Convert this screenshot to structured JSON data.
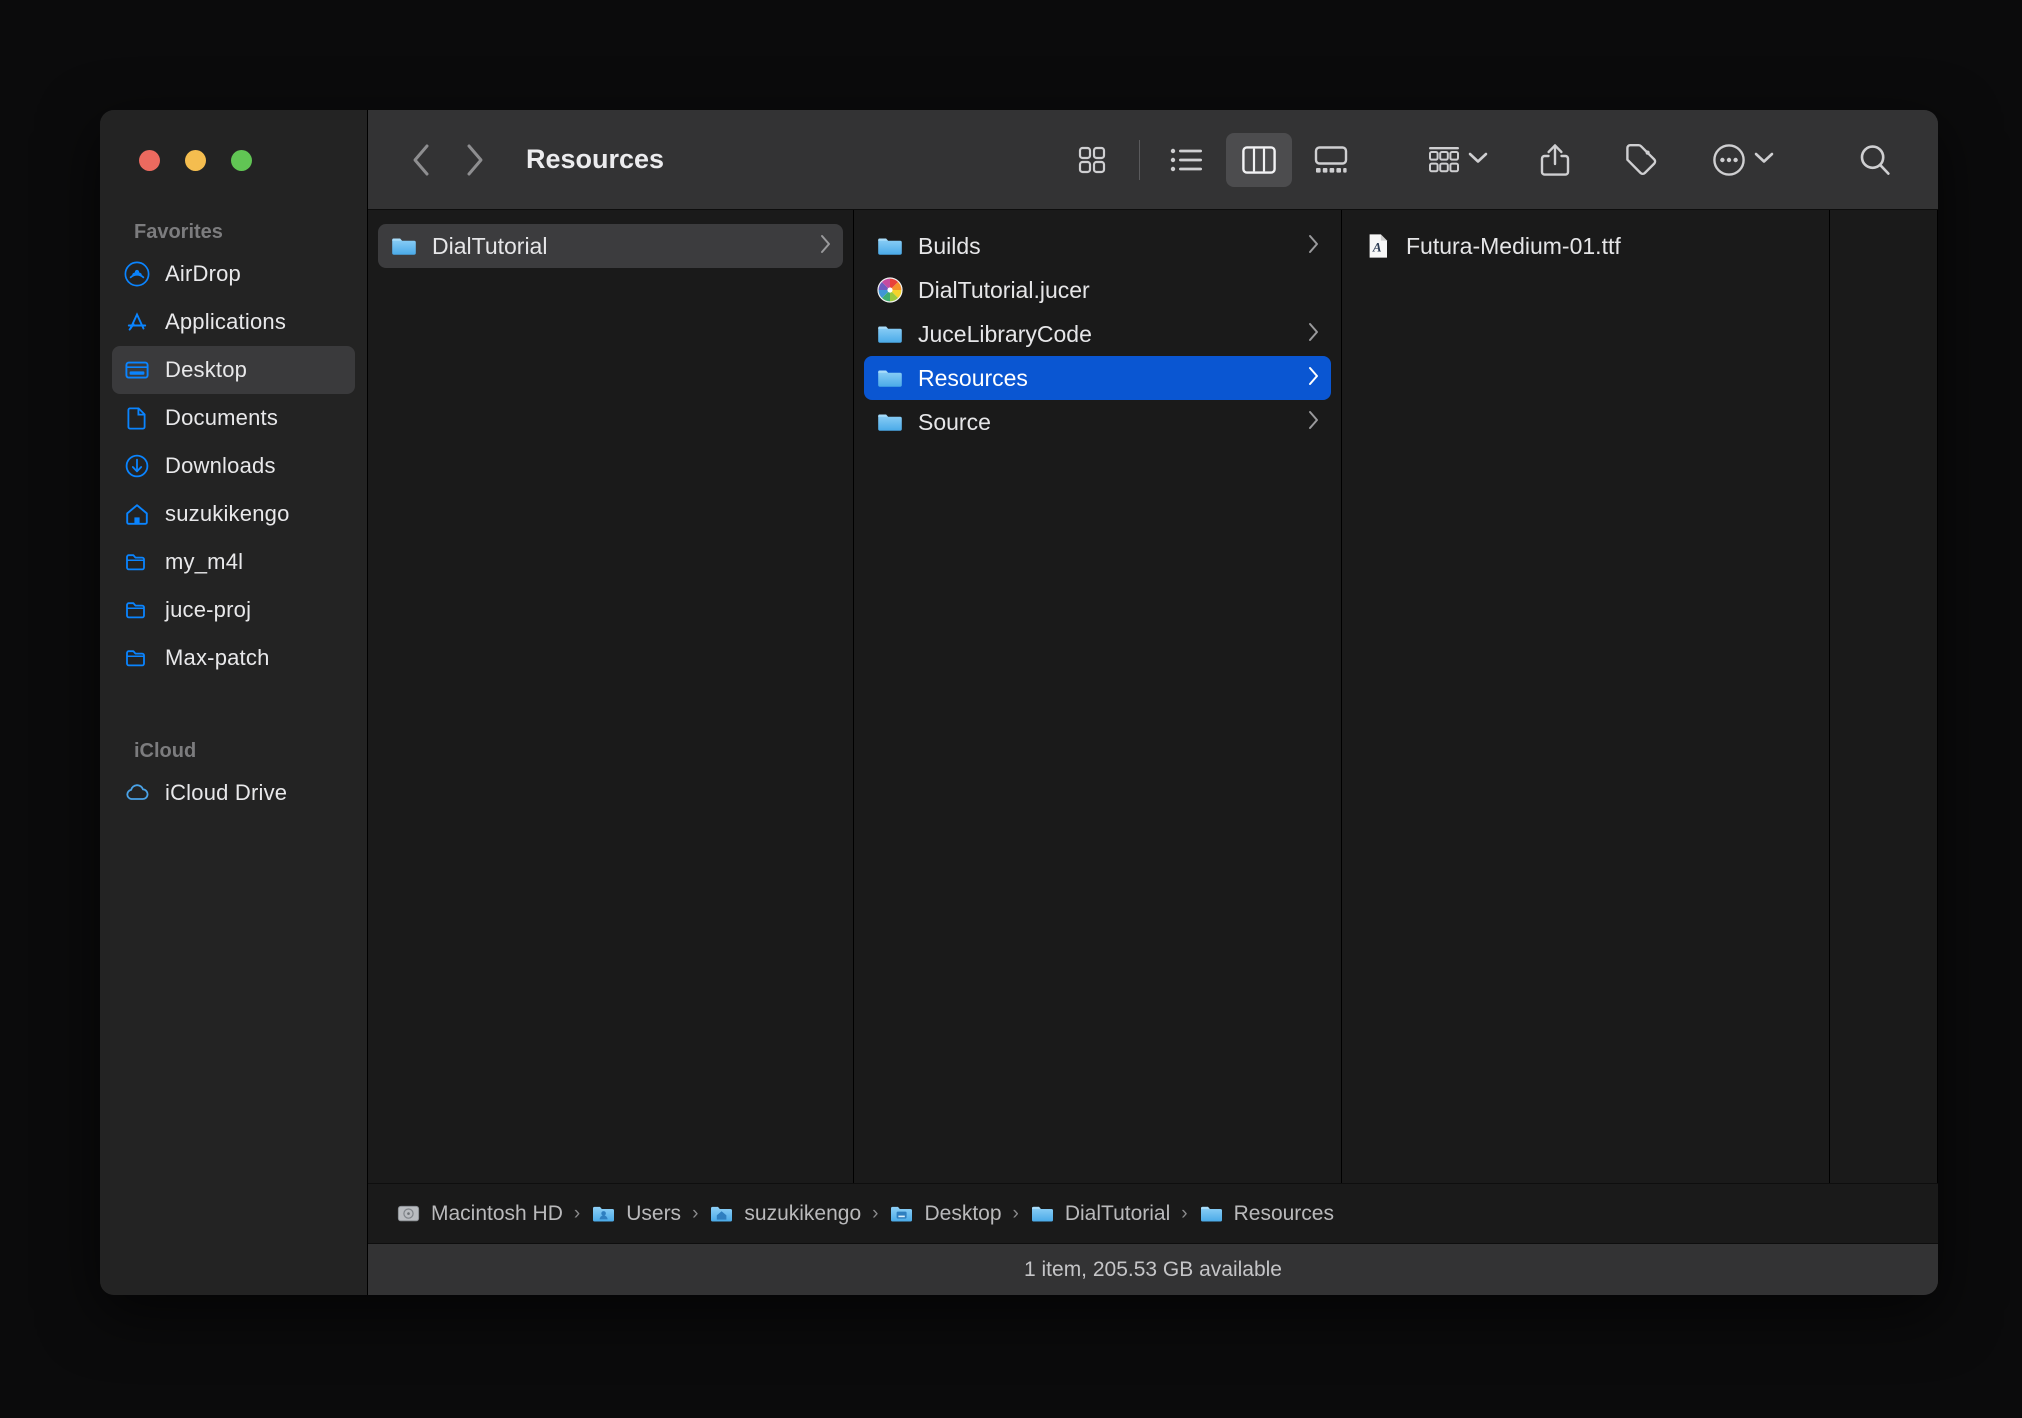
{
  "window": {
    "title": "Resources",
    "traffic_lights": [
      {
        "name": "close",
        "color": "#ec6a5f"
      },
      {
        "name": "minimize",
        "color": "#f4bd4f"
      },
      {
        "name": "maximize",
        "color": "#61c554"
      }
    ]
  },
  "colors": {
    "accent_selected": "#0a56d2",
    "selected_inactive": "#3c3c3e",
    "folder_blue": "#63b9f0",
    "sidebar_icon_blue": "#0a84ff",
    "toolbar_bg": "#333334",
    "sidebar_bg": "#232323",
    "content_bg": "#1a1a1a"
  },
  "toolbar": {
    "back_icon": "chevron-left-icon",
    "forward_icon": "chevron-right-icon",
    "view_modes": [
      {
        "name": "icon-view",
        "icon": "grid-icon",
        "active": false
      },
      {
        "name": "list-view",
        "icon": "list-icon",
        "active": false
      },
      {
        "name": "column-view",
        "icon": "columns-icon",
        "active": true
      },
      {
        "name": "gallery-view",
        "icon": "gallery-icon",
        "active": false
      }
    ],
    "actions": [
      {
        "name": "group-by",
        "icon": "group-icon",
        "has_chevron": true
      },
      {
        "name": "share",
        "icon": "share-icon",
        "has_chevron": false
      },
      {
        "name": "tags",
        "icon": "tag-icon",
        "has_chevron": false
      },
      {
        "name": "more",
        "icon": "ellipsis-circle-icon",
        "has_chevron": true
      },
      {
        "name": "search",
        "icon": "search-icon",
        "has_chevron": false
      }
    ]
  },
  "sidebar": {
    "sections": [
      {
        "label": "Favorites",
        "items": [
          {
            "label": "AirDrop",
            "icon": "airdrop-icon",
            "active": false
          },
          {
            "label": "Applications",
            "icon": "applications-icon",
            "active": false
          },
          {
            "label": "Desktop",
            "icon": "desktop-icon",
            "active": true
          },
          {
            "label": "Documents",
            "icon": "documents-icon",
            "active": false
          },
          {
            "label": "Downloads",
            "icon": "downloads-icon",
            "active": false
          },
          {
            "label": "suzukikengo",
            "icon": "home-icon",
            "active": false
          },
          {
            "label": "my_m4l",
            "icon": "folder-outline-icon",
            "active": false
          },
          {
            "label": "juce-proj",
            "icon": "folder-outline-icon",
            "active": false
          },
          {
            "label": "Max-patch",
            "icon": "folder-outline-icon",
            "active": false
          }
        ]
      },
      {
        "label": "iCloud",
        "items": [
          {
            "label": "iCloud Drive",
            "icon": "cloud-icon",
            "active": false
          }
        ]
      }
    ]
  },
  "columns": [
    {
      "name": "column-1",
      "items": [
        {
          "label": "DialTutorial",
          "icon": "folder-icon",
          "selection": "inactive",
          "has_chevron": true
        }
      ]
    },
    {
      "name": "column-2",
      "items": [
        {
          "label": "Builds",
          "icon": "folder-icon",
          "selection": "none",
          "has_chevron": true
        },
        {
          "label": "DialTutorial.jucer",
          "icon": "juce-pinwheel-icon",
          "selection": "none",
          "has_chevron": false
        },
        {
          "label": "JuceLibraryCode",
          "icon": "folder-icon",
          "selection": "none",
          "has_chevron": true
        },
        {
          "label": "Resources",
          "icon": "folder-icon",
          "selection": "active",
          "has_chevron": true
        },
        {
          "label": "Source",
          "icon": "folder-icon",
          "selection": "none",
          "has_chevron": true
        }
      ]
    },
    {
      "name": "column-3",
      "items": [
        {
          "label": "Futura-Medium-01.ttf",
          "icon": "font-file-icon",
          "selection": "none",
          "has_chevron": false
        }
      ]
    },
    {
      "name": "column-4",
      "items": []
    }
  ],
  "breadcrumb": [
    {
      "label": "Macintosh HD",
      "icon": "harddisk-icon"
    },
    {
      "label": "Users",
      "icon": "users-folder-icon"
    },
    {
      "label": "suzukikengo",
      "icon": "home-folder-icon"
    },
    {
      "label": "Desktop",
      "icon": "desktop-folder-icon"
    },
    {
      "label": "DialTutorial",
      "icon": "folder-icon"
    },
    {
      "label": "Resources",
      "icon": "folder-icon"
    }
  ],
  "breadcrumb_separator": "›",
  "status": {
    "text": "1 item, 205.53 GB available"
  }
}
